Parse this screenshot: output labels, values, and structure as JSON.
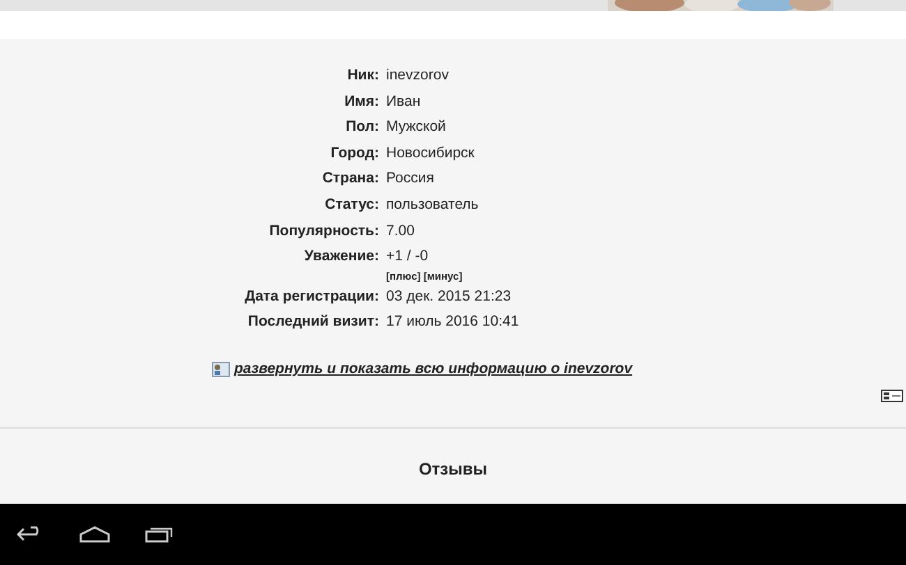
{
  "profile": [
    {
      "label": "Ник:",
      "value": "inevzorov"
    },
    {
      "label": "Имя:",
      "value": "Иван"
    },
    {
      "label": "Пол:",
      "value": "Мужской"
    },
    {
      "label": "Город:",
      "value": "Новосибирск"
    },
    {
      "label": "Страна:",
      "value": "Россия"
    },
    {
      "label": "Статус:",
      "value": "пользователь"
    },
    {
      "label": "Популярность:",
      "value": "7.00"
    },
    {
      "label": "Уважение:",
      "value": "+1 / -0",
      "links": [
        "[плюс]",
        "[минус]"
      ]
    },
    {
      "label": "Дата регистрации:",
      "value": "03 дек. 2015 21:23"
    },
    {
      "label": "Последний визит:",
      "value": "17 июль 2016 10:41"
    }
  ],
  "expand_link": "развернуть и показать всю информацию о inevzorov",
  "reviews": {
    "title": "Отзывы"
  }
}
